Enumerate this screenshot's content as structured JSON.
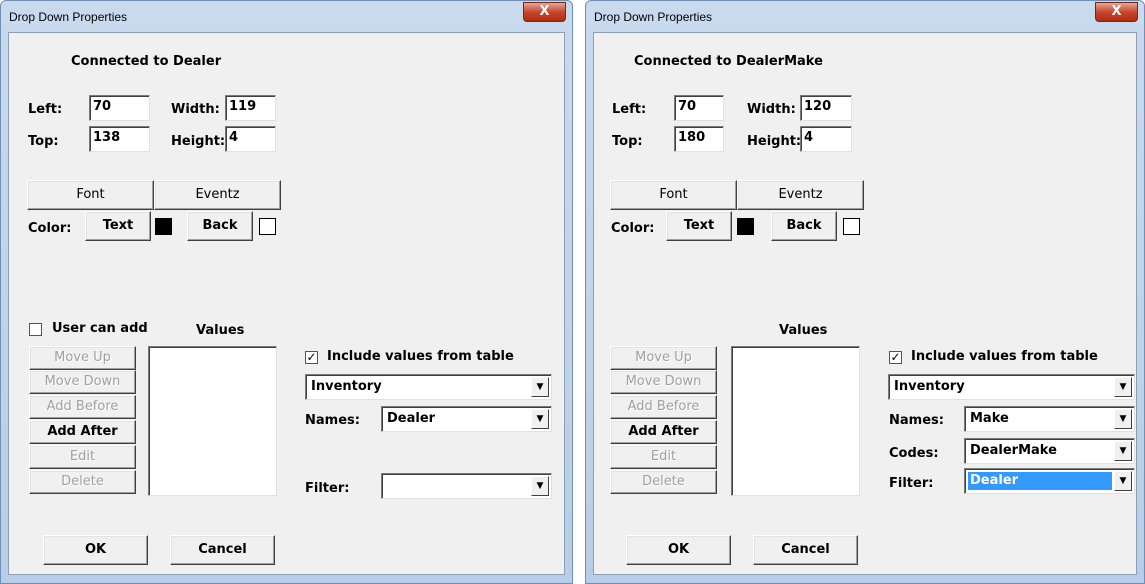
{
  "dialogs": [
    {
      "title": "Drop Down Properties",
      "close_glyph": "X",
      "connected": "Connected to Dealer",
      "left_label": "Left:",
      "left": "70",
      "top_label": "Top:",
      "top": "138",
      "width_label": "Width:",
      "width": "119",
      "height_label": "Height:",
      "height": "4",
      "font_button": "Font",
      "eventz_button": "Eventz",
      "color_label": "Color:",
      "text_button": "Text",
      "back_button": "Back",
      "user_can_add": "User can add",
      "values_label": "Values",
      "move_up": "Move Up",
      "move_down": "Move Down",
      "add_before": "Add Before",
      "add_after": "Add After",
      "edit": "Edit",
      "delete": "Delete",
      "include_label": "Include values from table",
      "include_checked": "✓",
      "table": "Inventory",
      "names_label": "Names:",
      "names": "Dealer",
      "filter_label": "Filter:",
      "filter": "",
      "ok": "OK",
      "cancel": "Cancel"
    },
    {
      "title": "Drop Down Properties",
      "close_glyph": "X",
      "connected": "Connected to DealerMake",
      "left_label": "Left:",
      "left": "70",
      "top_label": "Top:",
      "top": "180",
      "width_label": "Width:",
      "width": "120",
      "height_label": "Height:",
      "height": "4",
      "font_button": "Font",
      "eventz_button": "Eventz",
      "color_label": "Color:",
      "text_button": "Text",
      "back_button": "Back",
      "values_label": "Values",
      "move_up": "Move Up",
      "move_down": "Move Down",
      "add_before": "Add Before",
      "add_after": "Add After",
      "edit": "Edit",
      "delete": "Delete",
      "include_label": "Include values from table",
      "include_checked": "✓",
      "table": "Inventory",
      "names_label": "Names:",
      "names": "Make",
      "codes_label": "Codes:",
      "codes": "DealerMake",
      "filter_label": "Filter:",
      "filter": "Dealer",
      "ok": "OK",
      "cancel": "Cancel"
    }
  ],
  "colors": {
    "text_swatch": "#000000",
    "back_swatch": "#ffffff",
    "highlight": "#3399ff"
  },
  "icons": {
    "close": "close-icon",
    "dropdown": "chevron-down-icon"
  }
}
